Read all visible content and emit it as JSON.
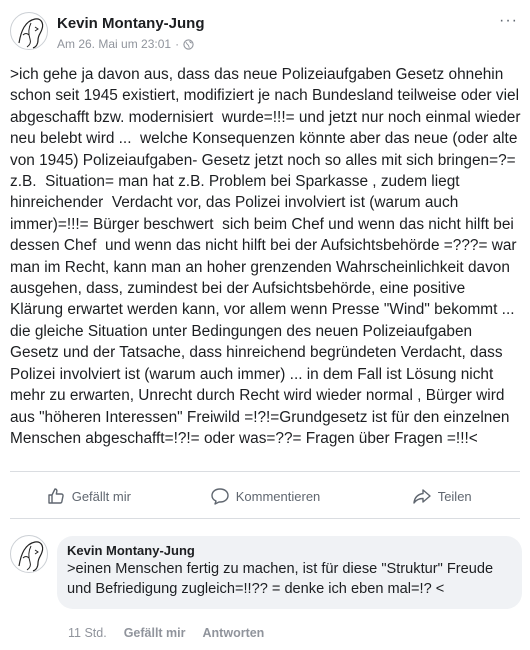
{
  "post": {
    "author": "Kevin Montany-Jung",
    "timestamp": "Am 26. Mai um 23:01",
    "separator": "·",
    "privacy_icon": "globe-icon",
    "more_label": "···",
    "text": ">ich gehe ja davon aus, dass das neue Polizeiaufgaben Gesetz ohnehin schon seit 1945 existiert, modifiziert je nach Bundesland teilweise oder viel abgeschafft bzw. modernisiert  wurde=!!!= und jetzt nur noch einmal wieder neu belebt wird ...  welche Konsequenzen könnte aber das neue (oder alte von 1945) Polizeiaufgaben- Gesetz jetzt noch so alles mit sich bringen=?= z.B.  Situation= man hat z.B. Problem bei Sparkasse , zudem liegt hinreichender  Verdacht vor, das Polizei involviert ist (warum auch immer)=!!!= Bürger beschwert  sich beim Chef und wenn das nicht hilft bei dessen Chef  und wenn das nicht hilft bei der Aufsichtsbehörde =???= war man im Recht, kann man an hoher grenzenden Wahrscheinlichkeit davon ausgehen, dass, zumindest bei der Aufsichtsbehörde, eine positive Klärung erwartet werden kann, vor allem wenn Presse \"Wind\" bekommt ... die gleiche Situation unter Bedingungen des neuen Polizeiaufgaben Gesetz und der Tatsache, dass hinreichend begründeten Verdacht, dass Polizei involviert ist (warum auch immer) ... in dem Fall ist Lösung nicht mehr zu erwarten, Unrecht durch Recht wird wieder normal , Bürger wird aus \"höheren Interessen\" Freiwild =!?!=Grundgesetz ist für den einzelnen Menschen abgeschafft=!?!= oder was=??= Fragen über Fragen =!!!<"
  },
  "actions": {
    "like": {
      "label": "Gefällt mir",
      "icon": "thumbs-up-icon"
    },
    "comment": {
      "label": "Kommentieren",
      "icon": "comment-icon"
    },
    "share": {
      "label": "Teilen",
      "icon": "share-icon"
    }
  },
  "comment": {
    "author": "Kevin Montany-Jung",
    "text": ">einen Menschen fertig zu machen, ist für diese \"Struktur\" Freude und Befriedigung zugleich=!!?? = denke ich eben mal=!? <",
    "time": "11 Std.",
    "like_label": "Gefällt mir",
    "reply_label": "Antworten"
  },
  "colors": {
    "text": "#1c1e21",
    "muted": "#90949c",
    "action": "#606770",
    "bubble": "#f0f2f5",
    "divider": "#dadde1"
  }
}
